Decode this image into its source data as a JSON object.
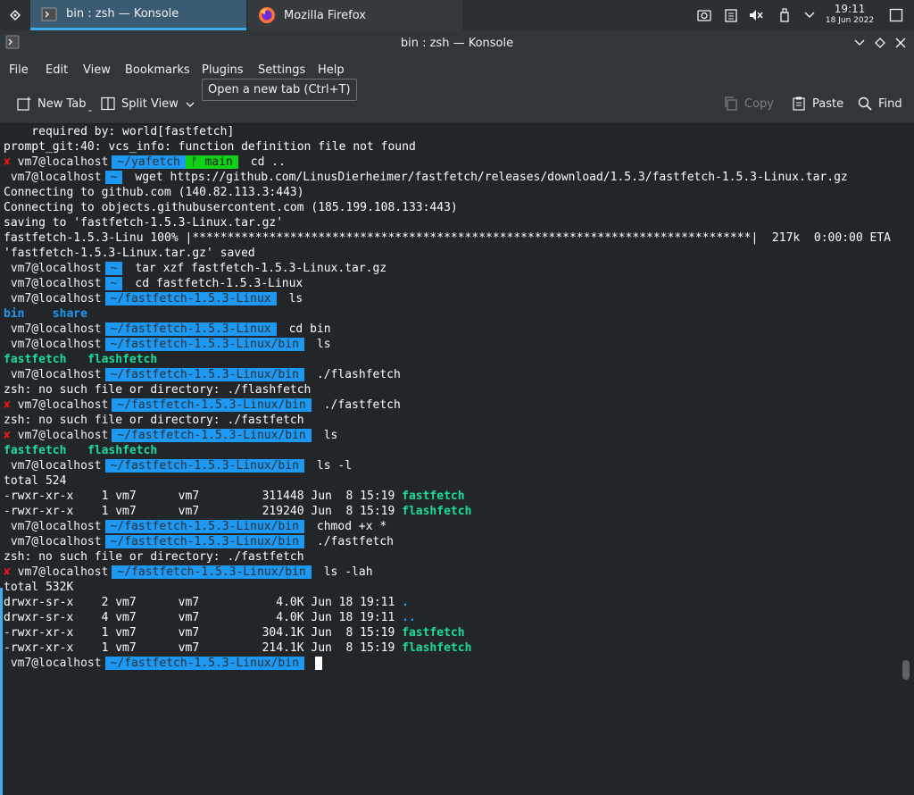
{
  "taskbar": {
    "tasks": [
      {
        "label": "bin : zsh — Konsole",
        "icon": "konsole-icon"
      },
      {
        "label": "Mozilla Firefox",
        "icon": "firefox-icon"
      }
    ],
    "clock": {
      "time": "19:11",
      "date": "18 Jun 2022"
    }
  },
  "window": {
    "title": "bin : zsh — Konsole"
  },
  "menu": [
    "File",
    "Edit",
    "View",
    "Bookmarks",
    "Plugins",
    "Settings",
    "Help"
  ],
  "toolbar": {
    "new_tab": "New Tab",
    "split_view": "Split View",
    "copy": "Copy",
    "paste": "Paste",
    "find": "Find"
  },
  "tooltip": "Open a new tab (Ctrl+T)",
  "terminal": {
    "host": "vm7@localhost",
    "lines": {
      "l0": "    required by: world[fastfetch]",
      "l1": "prompt_git:40: vcs_info: function definition file not found",
      "p2_dir": "~/yafetch",
      "p2_git": "ᚠ main",
      "p2_cmd": "cd ..",
      "p3_dir": "~",
      "p3_cmd": "wget https://github.com/LinusDierheimer/fastfetch/releases/download/1.5.3/fastfetch-1.5.3-Linux.tar.gz",
      "l4": "Connecting to github.com (140.82.113.3:443)",
      "l5": "Connecting to objects.githubusercontent.com (185.199.108.133:443)",
      "l6": "saving to 'fastfetch-1.5.3-Linux.tar.gz'",
      "l7": "fastfetch-1.5.3-Linu 100% |********************************************************************************|  217k  0:00:00 ETA",
      "l8": "'fastfetch-1.5.3-Linux.tar.gz' saved",
      "p9_dir": "~",
      "p9_cmd": "tar xzf fastfetch-1.5.3-Linux.tar.gz",
      "p10_dir": "~",
      "p10_cmd": "cd fastfetch-1.5.3-Linux",
      "p11_dir": "~/fastfetch-1.5.3-Linux",
      "p11_cmd": "ls",
      "ls1_a": "bin",
      "ls1_b": "share",
      "p13_dir": "~/fastfetch-1.5.3-Linux",
      "p13_cmd": "cd bin",
      "p14_dir": "~/fastfetch-1.5.3-Linux/bin",
      "p14_cmd": "ls",
      "ls2_a": "fastfetch",
      "ls2_b": "flashfetch",
      "p16_dir": "~/fastfetch-1.5.3-Linux/bin",
      "p16_cmd": "./flashfetch",
      "l17": "zsh: no such file or directory: ./flashfetch",
      "p18_dir": "~/fastfetch-1.5.3-Linux/bin",
      "p18_cmd": "./fastfetch",
      "l19": "zsh: no such file or directory: ./fastfetch",
      "p20_dir": "~/fastfetch-1.5.3-Linux/bin",
      "p20_cmd": "ls",
      "ls3_a": "fastfetch",
      "ls3_b": "flashfetch",
      "p22_dir": "~/fastfetch-1.5.3-Linux/bin",
      "p22_cmd": "ls -l",
      "l23": "total 524",
      "l24_pre": "-rwxr-xr-x    1 vm7      vm7         311448 Jun  8 15:19 ",
      "l24_name": "fastfetch",
      "l25_pre": "-rwxr-xr-x    1 vm7      vm7         219240 Jun  8 15:19 ",
      "l25_name": "flashfetch",
      "p26_dir": "~/fastfetch-1.5.3-Linux/bin",
      "p26_cmd": "chmod +x *",
      "p27_dir": "~/fastfetch-1.5.3-Linux/bin",
      "p27_cmd": "./fastfetch",
      "l28": "zsh: no such file or directory: ./fastfetch",
      "p29_dir": "~/fastfetch-1.5.3-Linux/bin",
      "p29_cmd": "ls -lah",
      "l30": "total 532K",
      "l31_pre": "drwxr-sr-x    2 vm7      vm7           4.0K Jun 18 19:11 ",
      "l31_name": ".",
      "l32_pre": "drwxr-sr-x    4 vm7      vm7           4.0K Jun 18 19:11 ",
      "l32_name": "..",
      "l33_pre": "-rwxr-xr-x    1 vm7      vm7         304.1K Jun  8 15:19 ",
      "l33_name": "fastfetch",
      "l34_pre": "-rwxr-xr-x    1 vm7      vm7         214.1K Jun  8 15:19 ",
      "l34_name": "flashfetch",
      "p35_dir": "~/fastfetch-1.5.3-Linux/bin"
    },
    "error_mark": "✘"
  },
  "colors": {
    "accent": "#3daee9",
    "prompt_dir": "#1d99f3",
    "prompt_git": "#11d116",
    "error": "#ed1515",
    "exec": "#1cdc9a"
  }
}
